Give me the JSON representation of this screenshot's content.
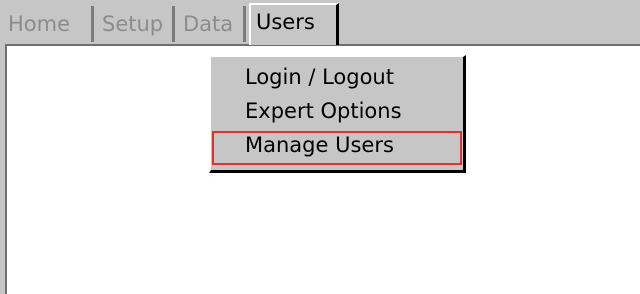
{
  "tabs": [
    {
      "label": "Home",
      "active": false
    },
    {
      "label": "Setup",
      "active": false
    },
    {
      "label": "Data",
      "active": false
    },
    {
      "label": "Users",
      "active": true
    }
  ],
  "menu": {
    "items": [
      {
        "label": "Login / Logout"
      },
      {
        "label": "Expert Options"
      },
      {
        "label": "Manage Users",
        "highlighted": true
      }
    ]
  },
  "colors": {
    "background": "#c6c6c6",
    "panel": "#ffffff",
    "highlight_border": "#e0312c",
    "inactive_text": "#8c8c8c"
  }
}
